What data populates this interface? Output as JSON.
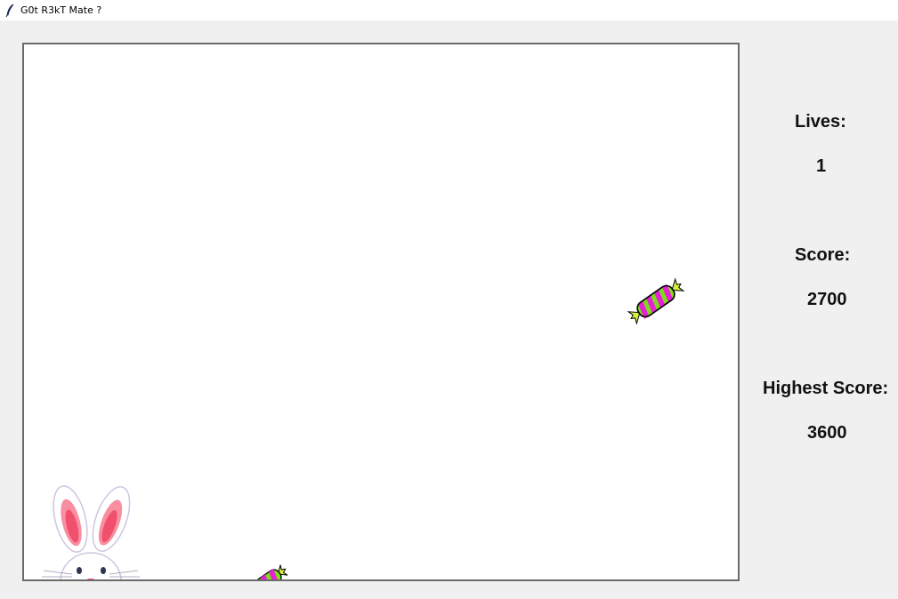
{
  "window": {
    "title": "G0t R3kT Mate ?",
    "icon": "feather-icon"
  },
  "game": {
    "player": "bunny",
    "items": [
      "candy",
      "candy"
    ]
  },
  "hud": {
    "lives_label": "Lives:",
    "lives": "1",
    "score_label": "Score:",
    "score": "2700",
    "high_label": "Highest Score:",
    "high": "3600"
  },
  "colors": {
    "window_bg": "#f0f0f0",
    "canvas_bg": "#ffffff",
    "canvas_border": "#6b6b6b",
    "candy_green": "#7cdc1c",
    "candy_magenta": "#e81ed8",
    "bunny_ear_inner": "#f0506e"
  }
}
